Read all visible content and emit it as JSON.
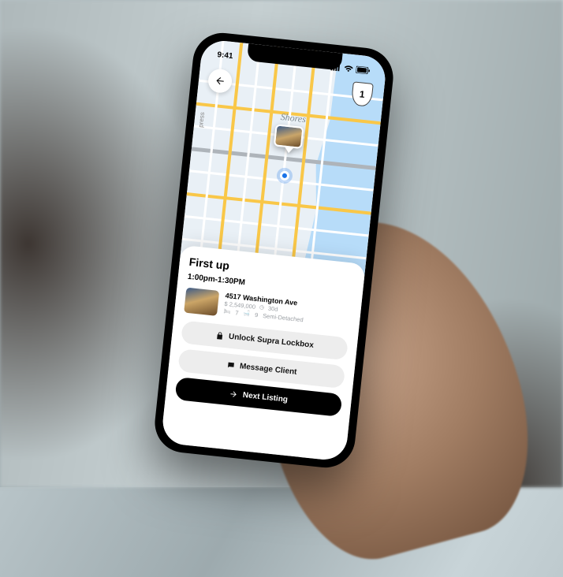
{
  "status": {
    "time": "9:41"
  },
  "map": {
    "area_label": "Shores",
    "route_shield": "1",
    "street_label": "press"
  },
  "sheet": {
    "heading": "First up",
    "time_range": "1:00pm-1:30PM",
    "listing": {
      "address": "4517 Washington Ave",
      "price": "$ 2,549,000",
      "lot": "30d",
      "beds": "7",
      "baths": "9",
      "type": "Semi-Detached"
    },
    "buttons": {
      "unlock": "Unlock Supra Lockbox",
      "message": "Message Client",
      "next": "Next Listing"
    }
  }
}
